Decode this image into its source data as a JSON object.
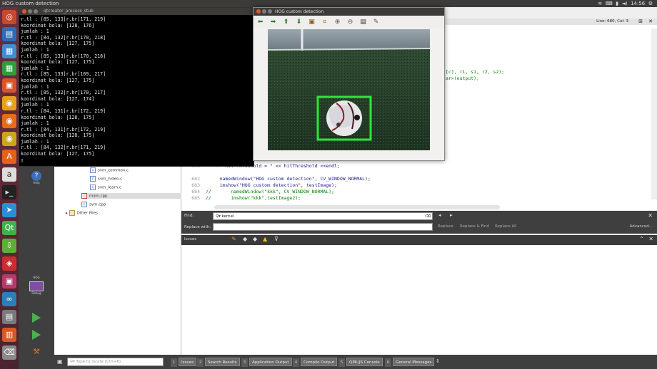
{
  "topbar": {
    "title": "HOG custom detection",
    "clock": "14:56"
  },
  "terminal": {
    "title": "qtcreator_process_stub",
    "lines": [
      "r.tl : [85, 133]r.br[171, 219]",
      "koordinat bola: [128, 176]",
      "jumlah : 1",
      "r.tl : [84, 132]r.br[170, 218]",
      "koordinat bola: [127, 175]",
      "jumlah : 1",
      "r.tl : [85, 133]r.br[170, 218]",
      "koordinat bola: [127, 175]",
      "jumlah : 1",
      "r.tl : [85, 133]r.br[169, 217]",
      "koordinat bola: [127, 175]",
      "jumlah : 1",
      "r.tl : [85, 132]r.br[170, 217]",
      "koordinat bola: [127, 174]",
      "jumlah : 1",
      "r.tl : [84, 131]r.br[172, 219]",
      "koordinat bola: [128, 175]",
      "jumlah : 1",
      "r.tl : [84, 131]r.br[172, 219]",
      "koordinat bola: [128, 175]",
      "jumlah : 1",
      "r.tl : [84, 132]r.br[171, 219]",
      "koordinat bola: [127, 175]",
      "▯"
    ]
  },
  "hog": {
    "title": "HOG custom detection"
  },
  "editor": {
    "status": "Line: 680, Col: 3",
    "partial1": "[c], r1, s1, r2, s2);",
    "partial2": "ar>(output);",
    "lines": [
      {
        "num": "681",
        "code": "   << \"hit Threshold = \" << hitThreshold <<endl;",
        "comment": false
      },
      {
        "num": "682",
        "code": "     namedWindow(\"HOG custom detection\", CV_WINDOW_NORMAL);",
        "comment": false
      },
      {
        "num": "683",
        "code": "     imshow(\"HOG custom detection\", testImage);",
        "comment": false
      },
      {
        "num": "684",
        "code": "//       namedWindow(\"kkk\", CV_WINDOW_NORMAL);",
        "comment": true
      },
      {
        "num": "685",
        "code": "//       imshow(\"kkk\",testImage2);",
        "comment": true
      }
    ]
  },
  "tree": {
    "items": [
      {
        "label": "svm_common.c"
      },
      {
        "label": "svm_hideo.c"
      },
      {
        "label": "svm_learn.c"
      },
      {
        "label": "main.cpp"
      },
      {
        "label": "svm.cpp"
      },
      {
        "label": "Other Files"
      }
    ]
  },
  "find": {
    "find_label": "Find:",
    "find_value": "kernel",
    "replace_label": "Replace with:",
    "replace": "Replace",
    "replace_find": "Replace & Find",
    "replace_all": "Replace All",
    "advanced": "Advanced..."
  },
  "issues": {
    "label": "Issues"
  },
  "modes": {
    "help": "Help",
    "project": "HOG",
    "debug": "Debug"
  },
  "bottombar": {
    "locate_placeholder": "Type to locate (Ctrl+K)",
    "tabs": [
      {
        "n": "1",
        "label": "Issues"
      },
      {
        "n": "2",
        "label": "Search Results"
      },
      {
        "n": "3",
        "label": "Application Output"
      },
      {
        "n": "4",
        "label": "Compile Output"
      },
      {
        "n": "5",
        "label": "QML/JS Console"
      },
      {
        "n": "6",
        "label": "General Messages"
      }
    ]
  },
  "colors": {
    "detection_box": "#2ee53a",
    "launcher": "#5a2a3a",
    "code_keyword": "#1a1a8a",
    "code_comment": "#008000"
  }
}
